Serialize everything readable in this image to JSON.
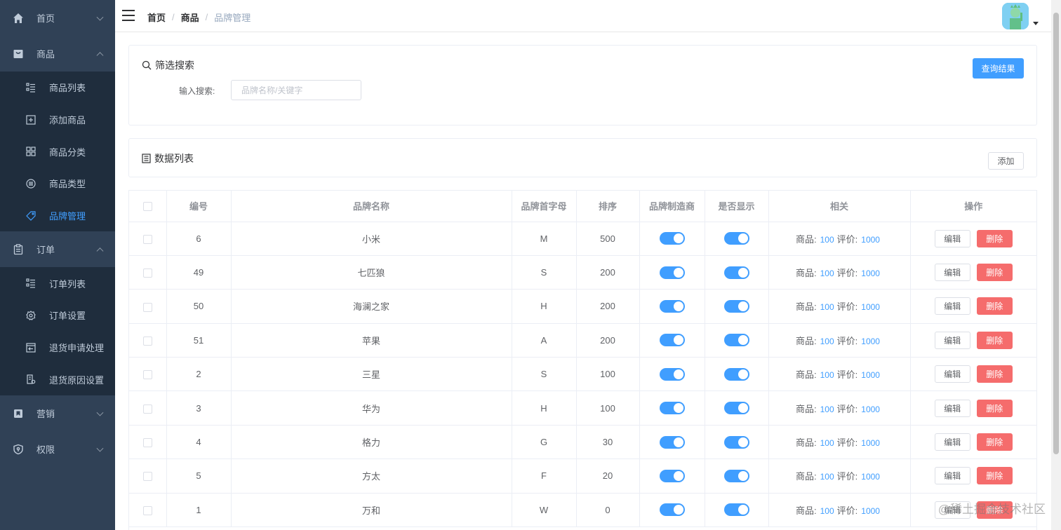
{
  "sidebar": {
    "home": "首页",
    "product": {
      "label": "商品",
      "items": [
        {
          "label": "商品列表",
          "icon": "list-icon"
        },
        {
          "label": "添加商品",
          "icon": "plus-square-icon"
        },
        {
          "label": "商品分类",
          "icon": "grid-icon"
        },
        {
          "label": "商品类型",
          "icon": "list-circle-icon"
        },
        {
          "label": "品牌管理",
          "icon": "tag-icon"
        }
      ]
    },
    "order": {
      "label": "订单",
      "items": [
        {
          "label": "订单列表",
          "icon": "list-icon"
        },
        {
          "label": "订单设置",
          "icon": "gear-icon"
        },
        {
          "label": "退货申请处理",
          "icon": "return-icon"
        },
        {
          "label": "退货原因设置",
          "icon": "doc-gear-icon"
        }
      ]
    },
    "marketing": "营销",
    "permission": "权限"
  },
  "breadcrumb": [
    "首页",
    "商品",
    "品牌管理"
  ],
  "filter": {
    "title": "筛选搜索",
    "query_button": "查询结果",
    "search_label": "输入搜索:",
    "search_placeholder": "品牌名称/关键字",
    "search_value": ""
  },
  "list": {
    "title": "数据列表",
    "add_button": "添加"
  },
  "table": {
    "columns": [
      "编号",
      "品牌名称",
      "品牌首字母",
      "排序",
      "品牌制造商",
      "是否显示",
      "相关",
      "操作"
    ],
    "rows": [
      {
        "id": "6",
        "name": "小米",
        "letter": "M",
        "sort": "500",
        "manufacturer": true,
        "show": true,
        "goods": "100",
        "comments": "1000"
      },
      {
        "id": "49",
        "name": "七匹狼",
        "letter": "S",
        "sort": "200",
        "manufacturer": true,
        "show": true,
        "goods": "100",
        "comments": "1000"
      },
      {
        "id": "50",
        "name": "海澜之家",
        "letter": "H",
        "sort": "200",
        "manufacturer": true,
        "show": true,
        "goods": "100",
        "comments": "1000"
      },
      {
        "id": "51",
        "name": "苹果",
        "letter": "A",
        "sort": "200",
        "manufacturer": true,
        "show": true,
        "goods": "100",
        "comments": "1000"
      },
      {
        "id": "2",
        "name": "三星",
        "letter": "S",
        "sort": "100",
        "manufacturer": true,
        "show": true,
        "goods": "100",
        "comments": "1000"
      },
      {
        "id": "3",
        "name": "华为",
        "letter": "H",
        "sort": "100",
        "manufacturer": true,
        "show": true,
        "goods": "100",
        "comments": "1000"
      },
      {
        "id": "4",
        "name": "格力",
        "letter": "G",
        "sort": "30",
        "manufacturer": true,
        "show": true,
        "goods": "100",
        "comments": "1000"
      },
      {
        "id": "5",
        "name": "方太",
        "letter": "F",
        "sort": "20",
        "manufacturer": true,
        "show": true,
        "goods": "100",
        "comments": "1000"
      },
      {
        "id": "1",
        "name": "万和",
        "letter": "W",
        "sort": "0",
        "manufacturer": true,
        "show": true,
        "goods": "100",
        "comments": "1000"
      }
    ],
    "goods_label": "商品:",
    "comments_label": "评价:",
    "edit_label": "编辑",
    "delete_label": "删除"
  },
  "watermark": "@稀土掘金技术社区",
  "colors": {
    "sidebar_bg": "#304156",
    "submenu_bg": "#1f2d3d",
    "accent": "#409eff",
    "danger": "#f56c6c"
  }
}
